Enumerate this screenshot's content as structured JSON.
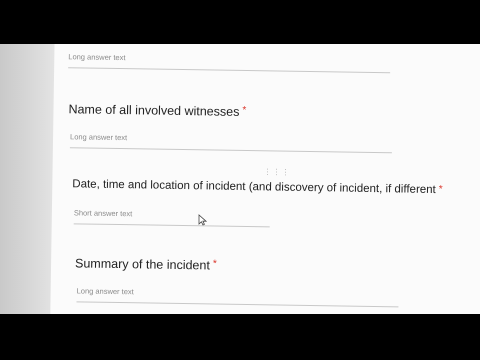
{
  "questions": [
    {
      "title": "",
      "required": false,
      "placeholder": "Long answer text"
    },
    {
      "title": "Name of all involved witnesses",
      "required": true,
      "placeholder": "Long answer text"
    },
    {
      "title": "Date, time and location of incident (and discovery of incident, if different",
      "required": true,
      "placeholder": "Short answer text"
    },
    {
      "title": "Summary of the incident",
      "required": true,
      "placeholder": "Long answer text"
    }
  ],
  "required_mark": "*",
  "drag_handle": "⋮⋮⋮",
  "icons": {
    "drag": "drag-handle-icon",
    "pointer": "mouse-pointer-icon"
  },
  "colors": {
    "required": "#d93025",
    "text": "#222222",
    "placeholder": "#8a8a8a"
  }
}
